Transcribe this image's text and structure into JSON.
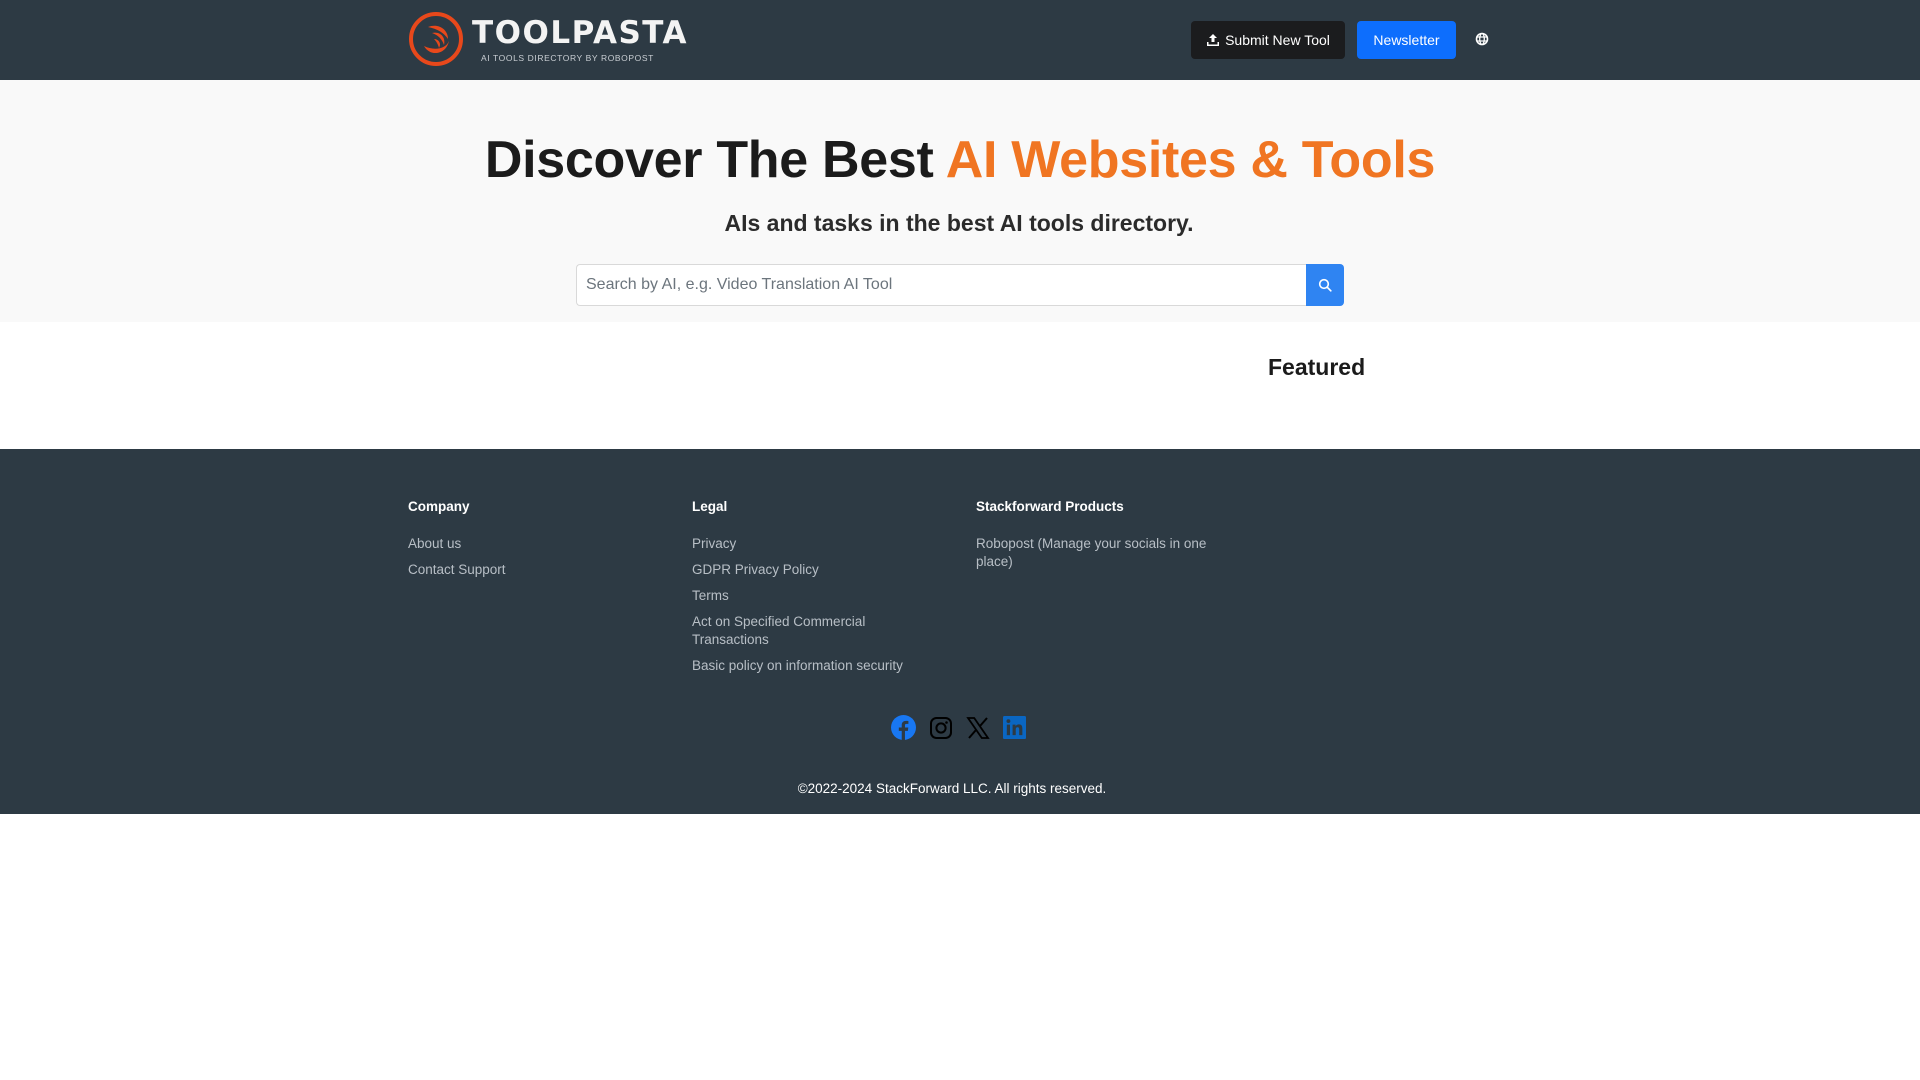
{
  "header": {
    "logo": {
      "title": "TOOLPASTA",
      "subtitle": "AI TOOLS DIRECTORY BY ROBOPOST",
      "icon": "swirl-logo-icon"
    },
    "submit_button": {
      "label": "Submit New Tool",
      "icon": "upload-icon"
    },
    "newsletter_button": {
      "label": "Newsletter"
    },
    "language_icon": "globe-icon"
  },
  "hero": {
    "title_prefix": "Discover The Best ",
    "title_accent": "AI Websites & Tools",
    "subtitle": "AIs and tasks in the best AI tools directory.",
    "search": {
      "placeholder": "Search by AI, e.g. Video Translation AI Tool",
      "value": "",
      "button_icon": "search-icon"
    }
  },
  "featured": {
    "title": "Featured"
  },
  "footer": {
    "columns": [
      {
        "heading": "Company",
        "links": [
          "About us",
          "Contact Support"
        ]
      },
      {
        "heading": "Legal",
        "links": [
          "Privacy",
          "GDPR Privacy Policy",
          "Terms",
          "Act on Specified Commercial Transactions",
          "Basic policy on information security"
        ]
      },
      {
        "heading": "Stackforward Products",
        "links": [
          "Robopost (Manage your socials in one place)"
        ]
      }
    ],
    "socials": [
      {
        "name": "facebook-icon",
        "color": "#1877f2"
      },
      {
        "name": "instagram-icon",
        "color": "#000000"
      },
      {
        "name": "x-icon",
        "color": "#000000"
      },
      {
        "name": "linkedin-icon",
        "color": "#0a66c2"
      }
    ],
    "copyright": "©2022-2024 StackForward LLC. All rights reserved."
  },
  "colors": {
    "header_bg": "#2d3a44",
    "accent_orange": "#f07522",
    "primary_blue": "#0d6efd",
    "search_blue": "#2f84f2",
    "hero_bg": "#f9f9f9"
  }
}
